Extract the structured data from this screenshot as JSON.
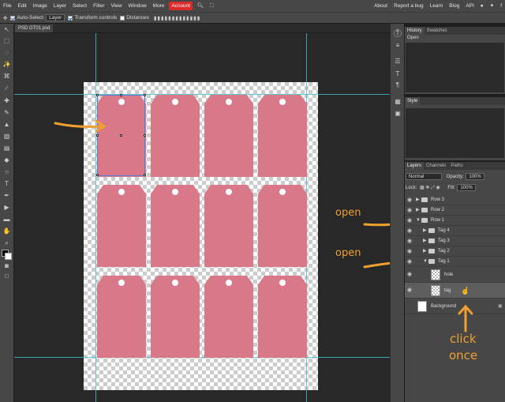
{
  "menubar": {
    "items": [
      "File",
      "Edit",
      "Image",
      "Layer",
      "Select",
      "Filter",
      "View",
      "Window",
      "More",
      "Account"
    ],
    "right": [
      "About",
      "Report a bug",
      "Learn",
      "Blog",
      "API"
    ]
  },
  "options": {
    "auto_select": "Auto-Select",
    "target": "Layer",
    "transform": "Transform controls",
    "distances": "Distances"
  },
  "document": {
    "tab": "PSD GT01.psd"
  },
  "panels": {
    "history": {
      "tabs": [
        "History",
        "Swatches"
      ],
      "items": [
        "Open"
      ]
    },
    "style": {
      "tab": "Style"
    },
    "layers": {
      "tabs": [
        "Layers",
        "Channels",
        "Paths"
      ],
      "blend": "Normal",
      "opacity_label": "Opacity:",
      "opacity": "100%",
      "lock_label": "Lock:",
      "fill_label": "Fill:",
      "fill": "100%",
      "rows": [
        {
          "name": "Row 3",
          "type": "folder",
          "open": false,
          "indent": 0
        },
        {
          "name": "Row 2",
          "type": "folder",
          "open": false,
          "indent": 0
        },
        {
          "name": "Row 1",
          "type": "folder",
          "open": true,
          "indent": 0
        },
        {
          "name": "Tag 4",
          "type": "folder",
          "open": false,
          "indent": 1
        },
        {
          "name": "Tag 3",
          "type": "folder",
          "open": false,
          "indent": 1
        },
        {
          "name": "Tag 2",
          "type": "folder",
          "open": false,
          "indent": 1
        },
        {
          "name": "Tag 1",
          "type": "folder",
          "open": true,
          "indent": 1
        },
        {
          "name": "hole",
          "type": "layer",
          "indent": 2
        },
        {
          "name": "tag",
          "type": "layer",
          "indent": 2
        },
        {
          "name": "Background",
          "type": "bg",
          "indent": 0
        }
      ]
    }
  },
  "annotations": {
    "open1": "open",
    "open2": "open",
    "click": "click",
    "once": "once"
  },
  "colors": {
    "tag": "#d97888",
    "accent": "#f0a030",
    "account": "#d92b2b"
  }
}
